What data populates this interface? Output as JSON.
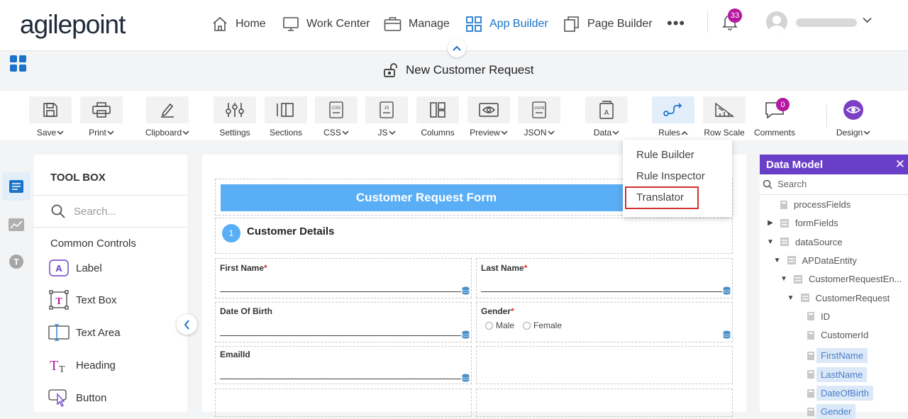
{
  "brand": {
    "logo": "agilepoint"
  },
  "nav": {
    "items": [
      {
        "label": "Home",
        "icon": "home-icon",
        "active": false
      },
      {
        "label": "Work Center",
        "icon": "monitor-icon",
        "active": false
      },
      {
        "label": "Manage",
        "icon": "briefcase-icon",
        "active": false
      },
      {
        "label": "App Builder",
        "icon": "grid-icon",
        "active": true
      },
      {
        "label": "Page Builder",
        "icon": "pages-icon",
        "active": false
      }
    ],
    "more": "•••",
    "notifications": "33"
  },
  "page": {
    "title": "New Customer Request"
  },
  "toolbar": {
    "save": "Save",
    "print": "Print",
    "clipboard": "Clipboard",
    "settings": "Settings",
    "sections": "Sections",
    "css": "CSS",
    "js": "JS",
    "columns": "Columns",
    "preview": "Preview",
    "json": "JSON",
    "data": "Data",
    "rules": "Rules",
    "row_scale": "Row Scale",
    "comments": "Comments",
    "comments_count": "0",
    "design": "Design"
  },
  "rules_menu": {
    "items": [
      "Rule Builder",
      "Rule Inspector",
      "Translator"
    ],
    "highlighted": "Translator"
  },
  "toolbox": {
    "title": "TOOL BOX",
    "search_placeholder": "Search...",
    "group": "Common Controls",
    "tools": [
      "Label",
      "Text Box",
      "Text Area",
      "Heading",
      "Button"
    ]
  },
  "form": {
    "header": "Customer Request Form",
    "section_number": "1",
    "section_title": "Customer Details",
    "fields": {
      "first_name": "First Name",
      "last_name": "Last Name",
      "dob": "Date Of Birth",
      "gender": "Gender",
      "email": "EmailId",
      "required_mark": "*"
    },
    "gender_options": [
      "Male",
      "Female"
    ]
  },
  "data_model": {
    "title": "Data Model",
    "search_placeholder": "Search",
    "tree": [
      {
        "label": "processFields",
        "toggle": "",
        "level": 0,
        "highlight": false
      },
      {
        "label": "formFields",
        "toggle": "▶",
        "level": 0,
        "highlight": false
      },
      {
        "label": "dataSource",
        "toggle": "▼",
        "level": 0,
        "highlight": false
      },
      {
        "label": "APDataEntity",
        "toggle": "▼",
        "level": 1,
        "highlight": false
      },
      {
        "label": "CustomerRequestEn...",
        "toggle": "▼",
        "level": 2,
        "highlight": false
      },
      {
        "label": "CustomerRequest",
        "toggle": "▼",
        "level": 3,
        "highlight": false
      },
      {
        "label": "ID",
        "toggle": "",
        "level": 4,
        "highlight": false
      },
      {
        "label": "CustomerId",
        "toggle": "",
        "level": 4,
        "highlight": false
      },
      {
        "label": "FirstName",
        "toggle": "",
        "level": 4,
        "highlight": true
      },
      {
        "label": "LastName",
        "toggle": "",
        "level": 4,
        "highlight": true
      },
      {
        "label": "DateOfBirth",
        "toggle": "",
        "level": 4,
        "highlight": true
      },
      {
        "label": "Gender",
        "toggle": "",
        "level": 4,
        "highlight": true
      }
    ]
  },
  "colors": {
    "accent": "#1a73c8",
    "form_header": "#5aaef5",
    "data_model_header": "#6a3fc7",
    "badge": "#b5179e",
    "highlight_box": "#d32f2f"
  }
}
